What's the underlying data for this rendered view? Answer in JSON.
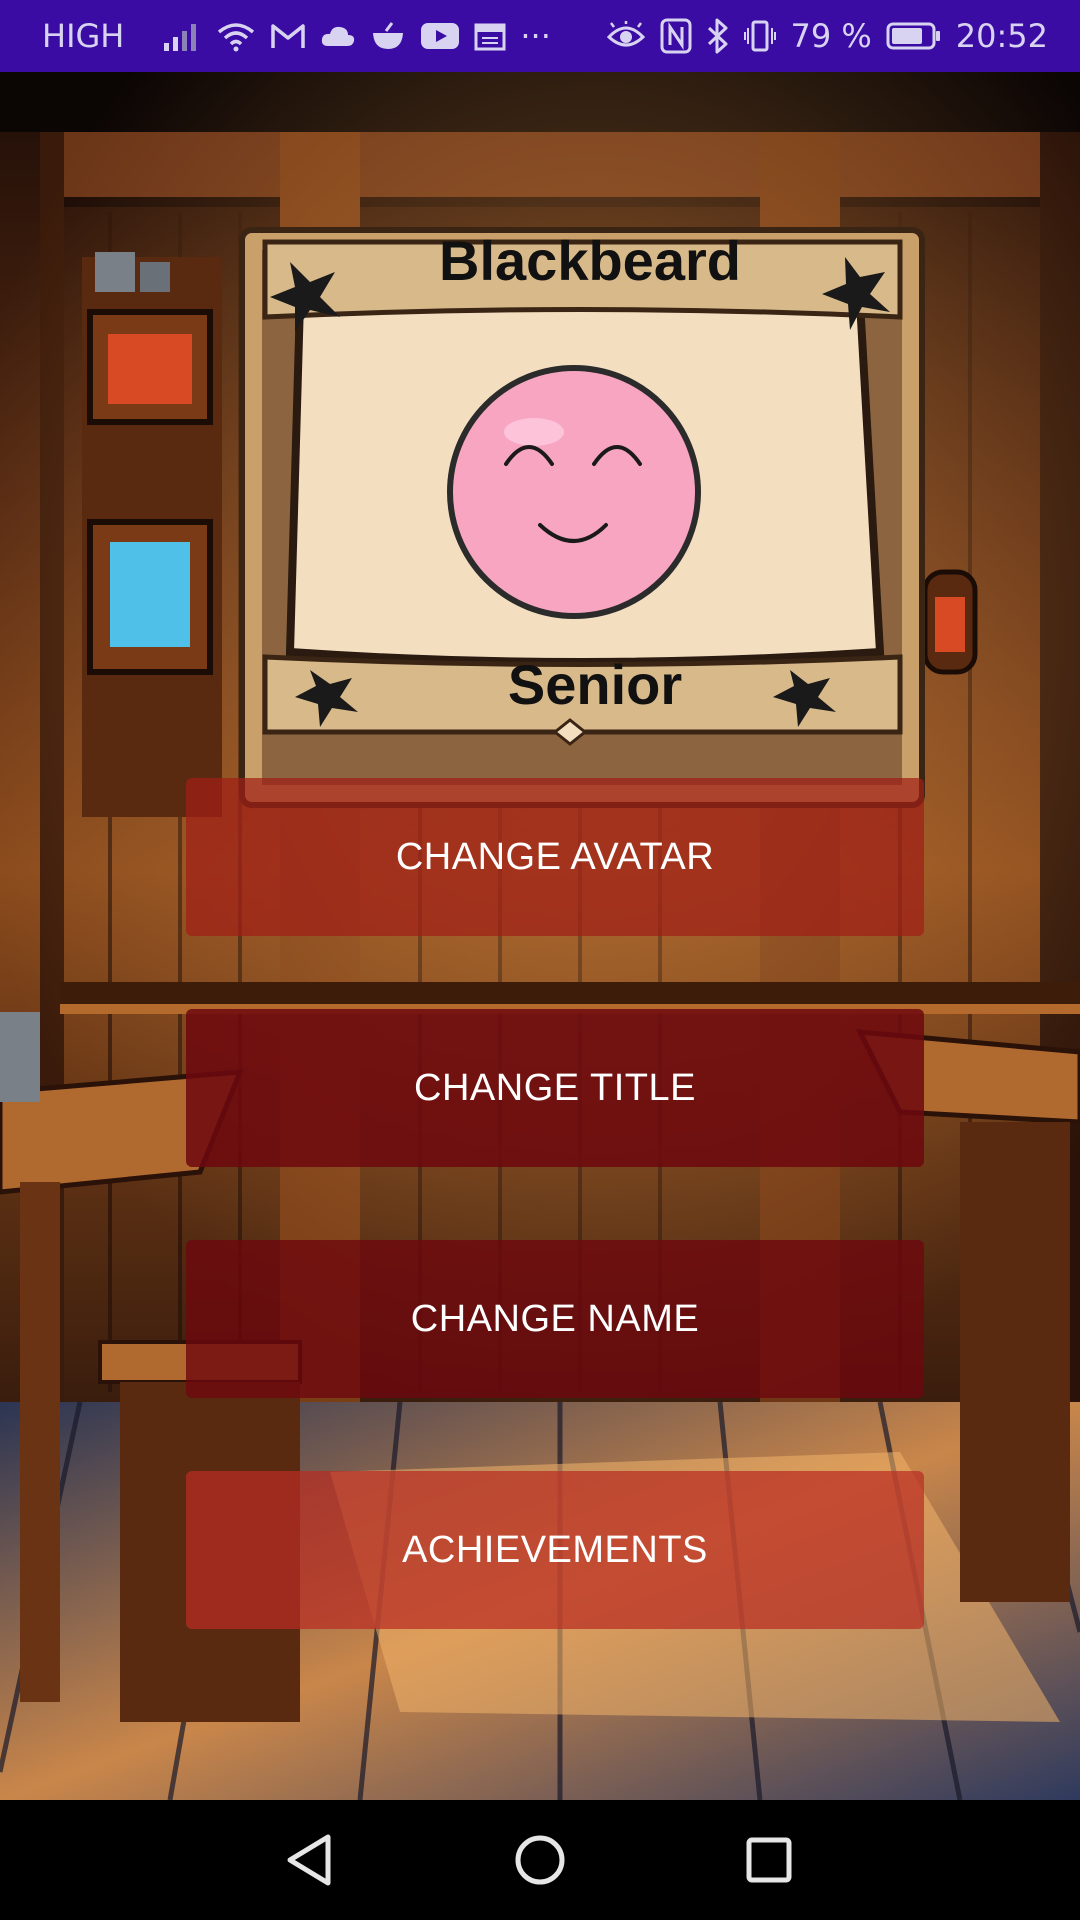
{
  "status_bar": {
    "network_label": "HIGH",
    "more_label": "···",
    "battery_percent": "79 %",
    "time": "20:52"
  },
  "profile": {
    "name": "Blackbeard",
    "title": "Senior",
    "avatar_color": "#f8a5c2"
  },
  "menu": {
    "change_avatar": "CHANGE AVATAR",
    "change_title": "CHANGE TITLE",
    "change_name": "CHANGE NAME",
    "achievements": "ACHIEVEMENTS"
  },
  "colors": {
    "status_bar": "#3a0ca3",
    "button_dark": "#6e080e",
    "button_light": "#b92d23"
  }
}
